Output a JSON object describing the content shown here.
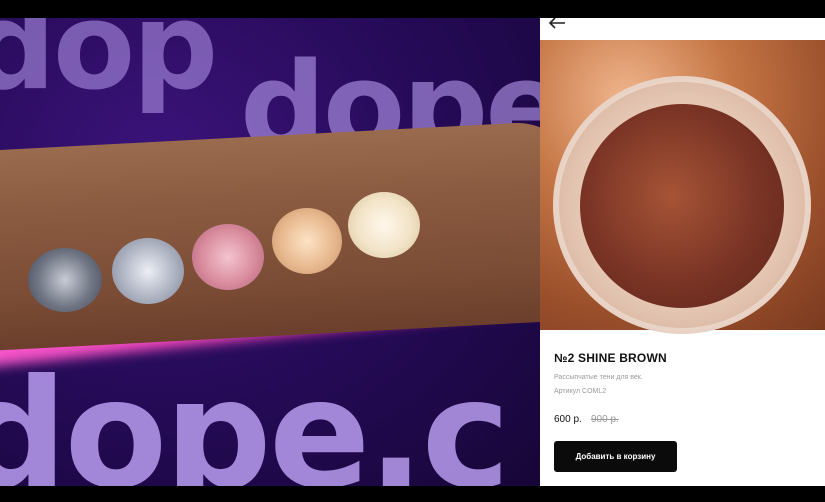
{
  "promo": {
    "watermark_top_left": "dop",
    "watermark_top_right": "dope.",
    "watermark_bottom": "dope.c"
  },
  "product": {
    "back_icon": "arrow-left-icon",
    "title": "№2 SHINE BROWN",
    "description": "Рассыпчатые тени для век.",
    "sku": "Артикул COML2",
    "price": "600 р.",
    "old_price": "900 р.",
    "add_to_cart_label": "Добавить в корзину"
  },
  "colors": {
    "background": "#000000",
    "panel_bg": "#ffffff",
    "button_bg": "#0b0b0b",
    "button_text": "#ffffff",
    "watermark": "#b99cf0"
  }
}
